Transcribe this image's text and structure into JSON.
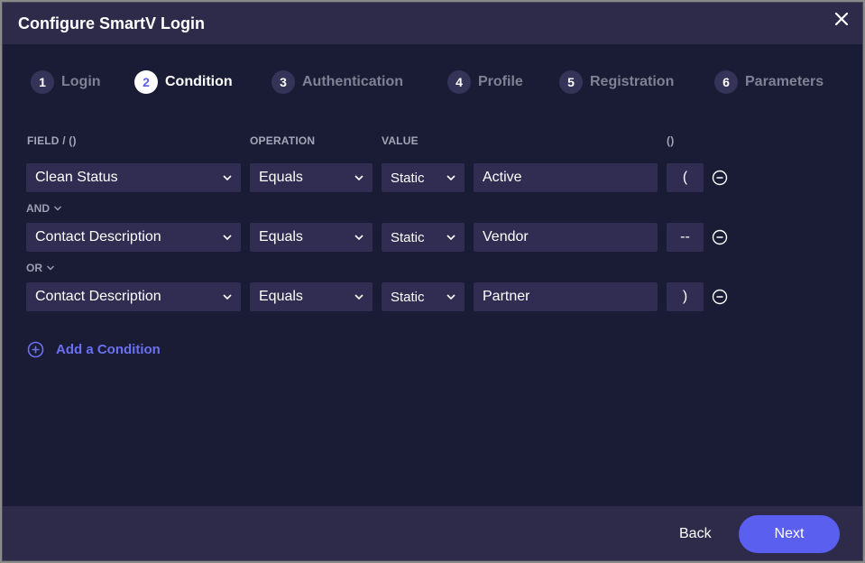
{
  "dialog": {
    "title": "Configure SmartV Login"
  },
  "steps": [
    {
      "num": "1",
      "label": "Login",
      "active": false
    },
    {
      "num": "2",
      "label": "Condition",
      "active": true
    },
    {
      "num": "3",
      "label": "Authentication",
      "active": false
    },
    {
      "num": "4",
      "label": "Profile",
      "active": false
    },
    {
      "num": "5",
      "label": "Registration",
      "active": false
    },
    {
      "num": "6",
      "label": "Parameters",
      "active": false
    }
  ],
  "columns": {
    "field": "FIELD / ()",
    "operation": "OPERATION",
    "value": "VALUE",
    "parens": "()"
  },
  "rows": [
    {
      "field": "Clean Status",
      "operation": "Equals",
      "value_type": "Static",
      "value": "Active",
      "paren": "("
    },
    {
      "field": "Contact Description",
      "operation": "Equals",
      "value_type": "Static",
      "value": "Vendor",
      "paren": "--"
    },
    {
      "field": "Contact Description",
      "operation": "Equals",
      "value_type": "Static",
      "value": "Partner",
      "paren": ")"
    }
  ],
  "connectors": [
    "AND",
    "OR"
  ],
  "add_condition": "Add a Condition",
  "footer": {
    "back": "Back",
    "next": "Next"
  },
  "colors": {
    "accent": "#5b5ff0",
    "background": "#1a1c36",
    "panel": "#2d2a4a",
    "field": "#302c52"
  }
}
